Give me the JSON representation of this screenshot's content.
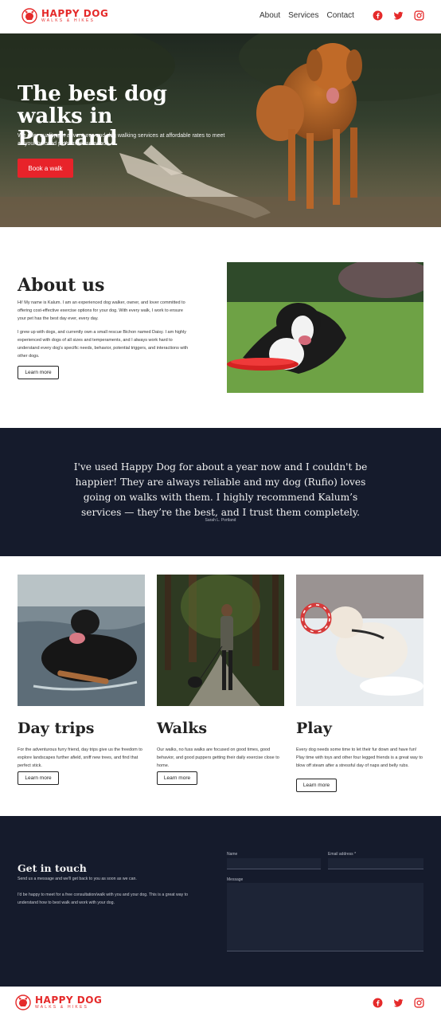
{
  "brand": {
    "name": "HAPPY DOG",
    "tagline": "WALKS & HIKES",
    "color": "#e52a2a"
  },
  "nav": {
    "items": [
      {
        "label": "About"
      },
      {
        "label": "Services"
      },
      {
        "label": "Contact"
      }
    ]
  },
  "socials": [
    "facebook-icon",
    "twitter-icon",
    "instagram-icon"
  ],
  "hero": {
    "title_line1": "The best dog",
    "title_line2": "walks in Portland",
    "subtitle": "We offer quality pet adventures and dog walking services at affordable rates to meet all your beloved pet's exercise needs.",
    "cta_label": "Book a walk",
    "cta_color": "#e8232a"
  },
  "about": {
    "title": "About us",
    "paragraph1": "Hi! My name is Kalum. I am an experienced dog walker, owner, and lover committed to offering cost-effective exercise options for your dog. With every walk, I work to ensure your pet has the best day ever, every day.",
    "paragraph2": "I grew up with dogs, and currently own a small rescue Bichon named Daisy. I am highly experienced with dogs of all sizes and temperaments, and I always work hard to understand every dog's specific needs, behavior, potential triggers, and interactions with other dogs.",
    "button_label": "Learn more"
  },
  "testimonial": {
    "quote": "I've used Happy Dog for about a year now and I couldn't be happier! They are always reliable and my dog (Rufio) loves going on walks with them. I highly recommend Kalum’s services — they’re the best, and I trust them completely.",
    "author": "Sarah L. Portland",
    "background": "#151b2c"
  },
  "services": [
    {
      "title": "Day trips",
      "text": "For the adventurous furry friend, day trips give us the freedom to explore landscapes further afield, sniff new trees, and find that perfect stick.",
      "button_label": "Learn more"
    },
    {
      "title": "Walks",
      "text": "Our walks, no fuss walks are focused on good times, good behavior, and good puppers getting their daily exercise close to home.",
      "button_label": "Learn more"
    },
    {
      "title": "Play",
      "text": "Every dog needs some time to let their fur down and have fun! Play time with toys and other four legged friends is a great way to blow off steam after a stressful day of naps and belly rubs.",
      "button_label": "Learn more"
    }
  ],
  "contact": {
    "title": "Get in touch",
    "subtitle": "Send us a message and we'll get back to you as soon as we can.",
    "paragraph": "I'd be happy to meet for a free consultation/walk with you and your dog. This is a great way to understand how to best walk and work with your dog.",
    "name_label": "Name",
    "email_label": "Email address *",
    "message_label": "Message",
    "name_value": "",
    "email_value": "",
    "message_value": ""
  }
}
